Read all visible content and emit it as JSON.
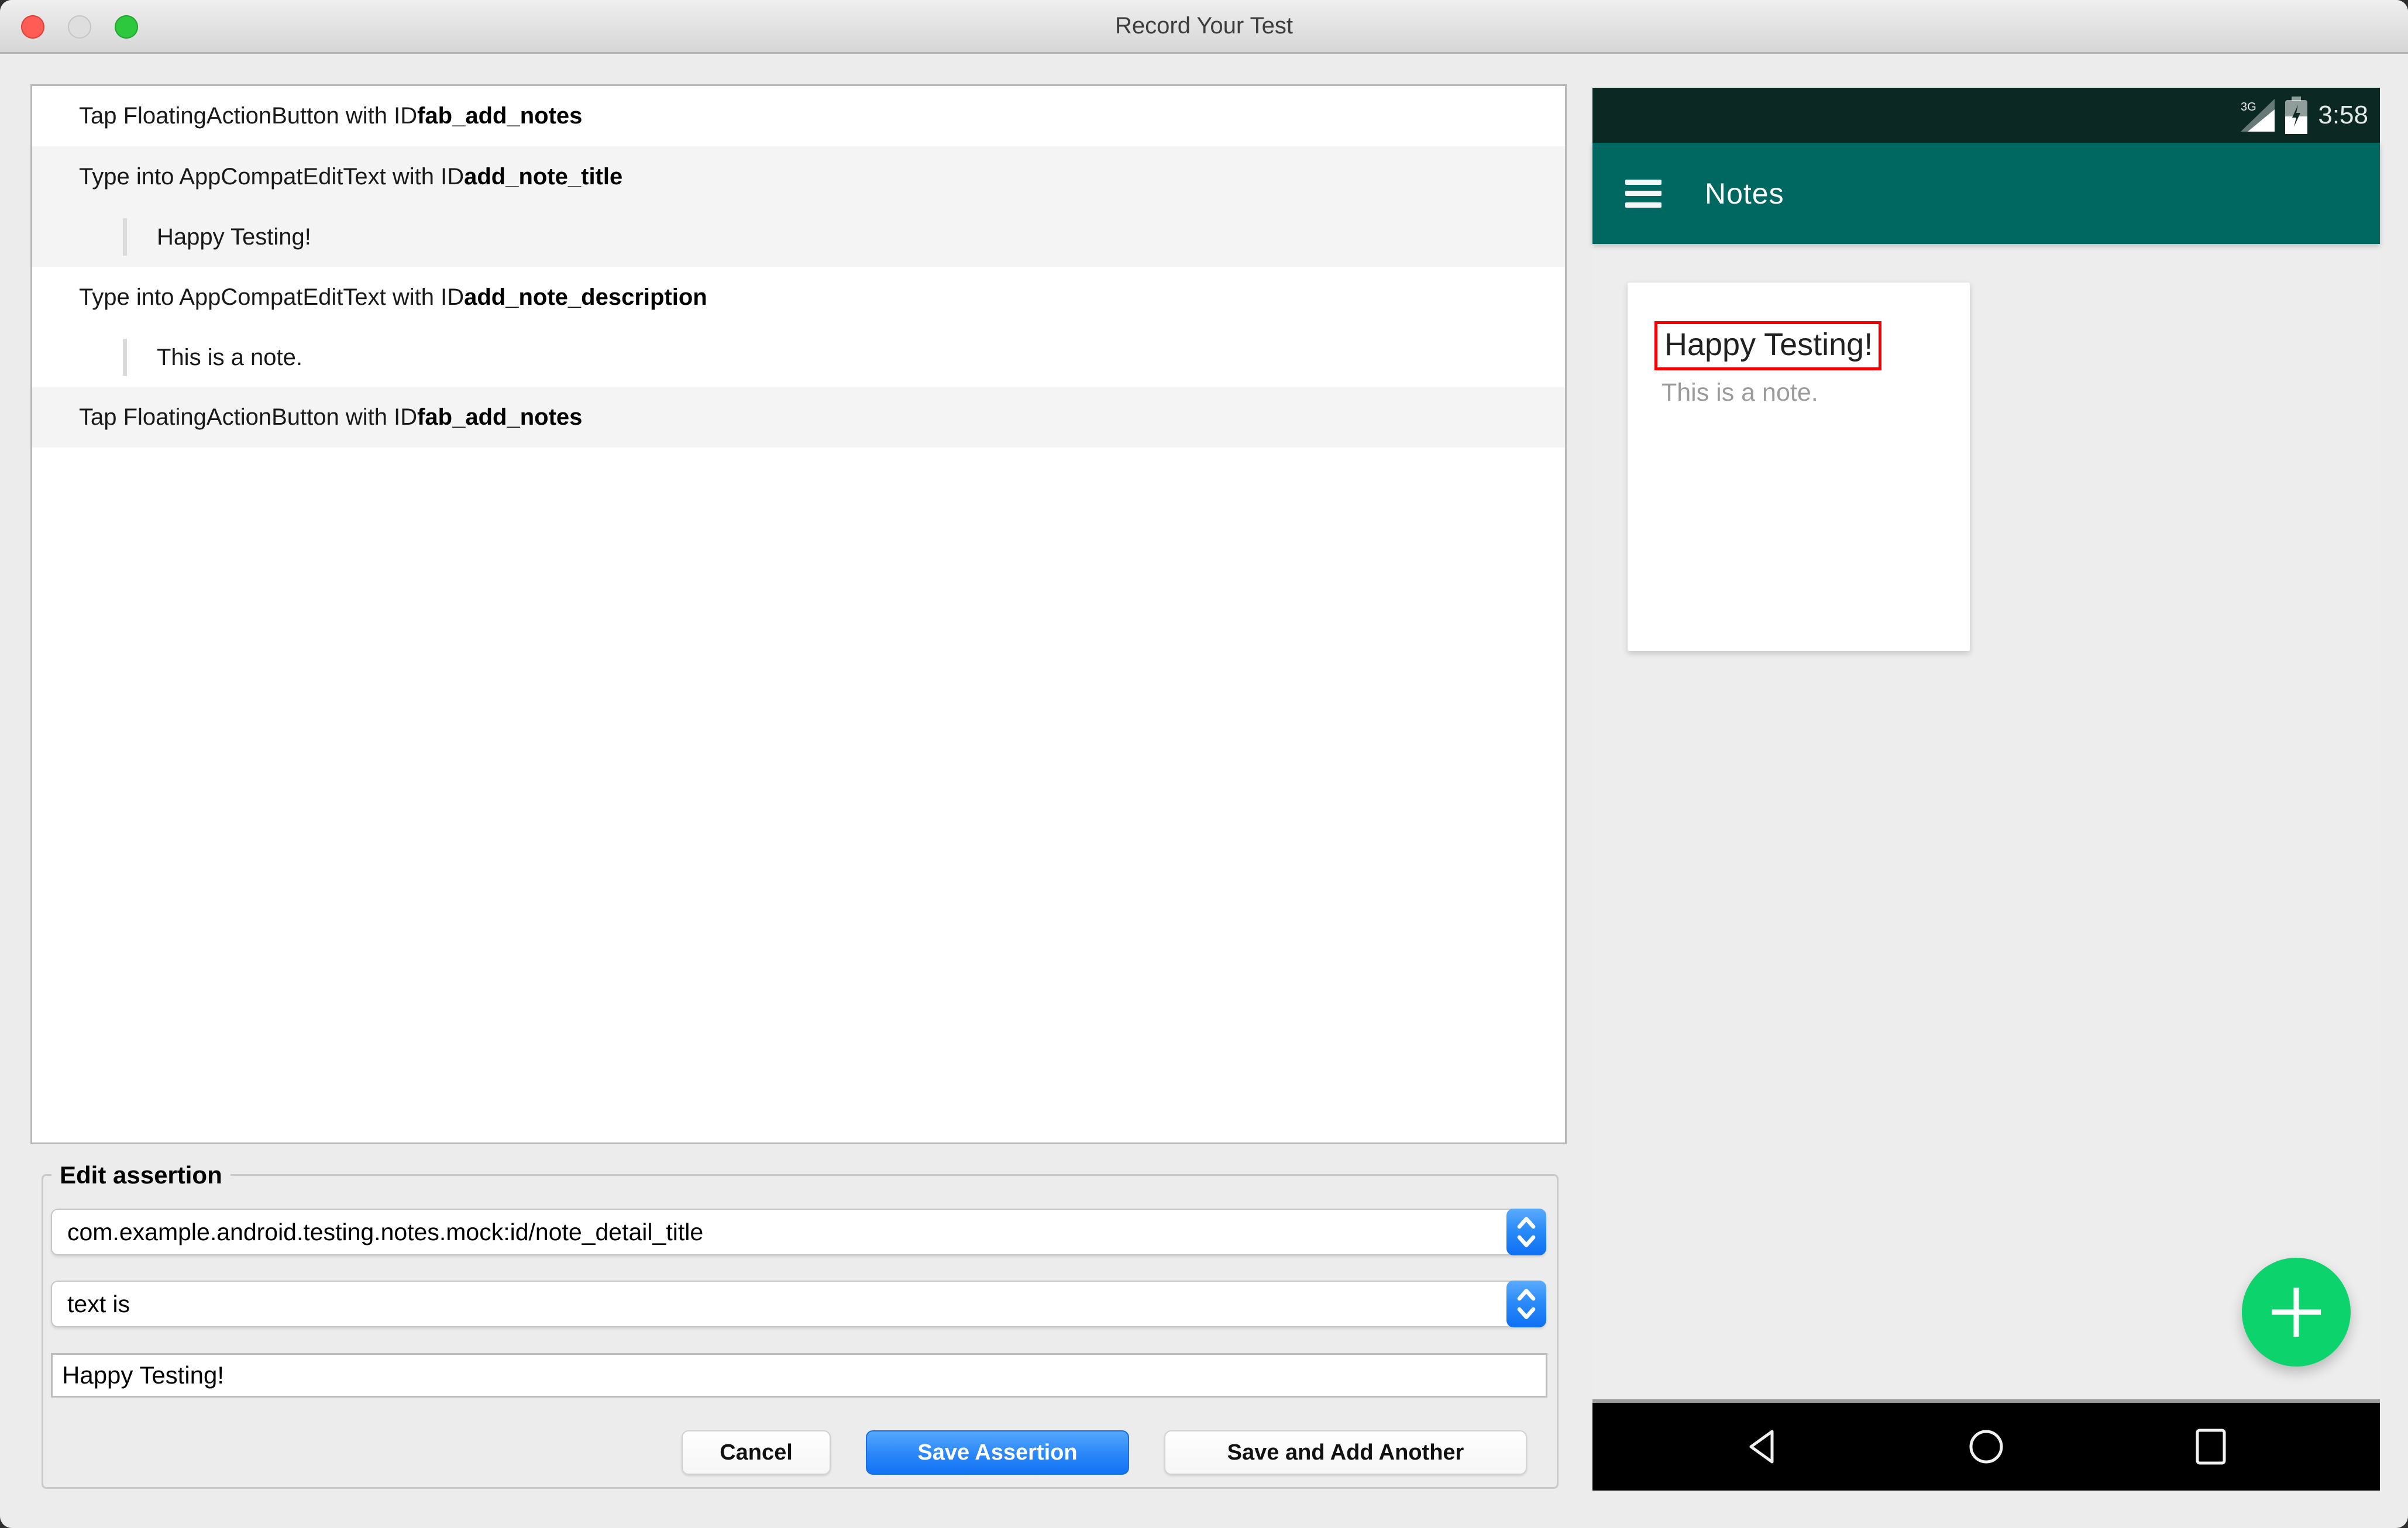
{
  "window": {
    "title": "Record Your Test"
  },
  "action_list": {
    "items": [
      {
        "action": "Tap FloatingActionButton with ID ",
        "target_id": "fab_add_notes"
      },
      {
        "action": "Type into AppCompatEditText with ID ",
        "target_id": "add_note_title",
        "value": "Happy Testing!"
      },
      {
        "action": "Type into AppCompatEditText with ID ",
        "target_id": "add_note_description",
        "value": "This is a note."
      },
      {
        "action": "Tap FloatingActionButton with ID ",
        "target_id": "fab_add_notes"
      }
    ]
  },
  "edit_assertion": {
    "legend": "Edit assertion",
    "view_id": "com.example.android.testing.notes.mock:id/note_detail_title",
    "assertion_type": "text is",
    "value": "Happy Testing!",
    "cancel_label": "Cancel",
    "save_label": "Save Assertion",
    "save_add_label": "Save and Add Another"
  },
  "device": {
    "status_bar": {
      "network": "3G",
      "time": "3:58"
    },
    "app_bar": {
      "title": "Notes"
    },
    "note_card": {
      "title": "Happy Testing!",
      "description": "This is a note."
    },
    "icons": {
      "app_bar_left": "hamburger-menu",
      "fab": "plus",
      "nav": [
        "back",
        "home",
        "recents"
      ],
      "status": [
        "signal-3g",
        "battery-charging"
      ]
    }
  },
  "colors": {
    "app_bar": "#006861",
    "status_bar": "#0b2823",
    "fab_green": "#0cd36c",
    "accent_blue": "#1372f5",
    "highlight_red": "#f50000",
    "nav_black": "#000000"
  }
}
